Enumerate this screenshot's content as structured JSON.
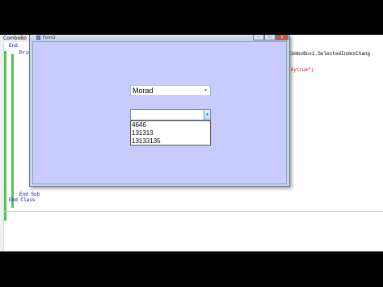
{
  "window": {
    "title": "Form2",
    "minimize_label": "–",
    "maximize_label": "□",
    "close_label": "x"
  },
  "editor": {
    "tab_label": "ComboBo",
    "line_end1": "End",
    "line_private": "Priv",
    "line_handles": "andles ComboBox1.SelectedIndexChang",
    "line_string": "\"Xytrue\")",
    "line_end_sub": "End Sub",
    "line_end_class": "End Class"
  },
  "combobox1": {
    "value": "Morad",
    "arrow": "▾"
  },
  "combobox2": {
    "value": "",
    "arrow": "▾",
    "items": [
      "4646",
      "131313",
      "13133135"
    ]
  }
}
